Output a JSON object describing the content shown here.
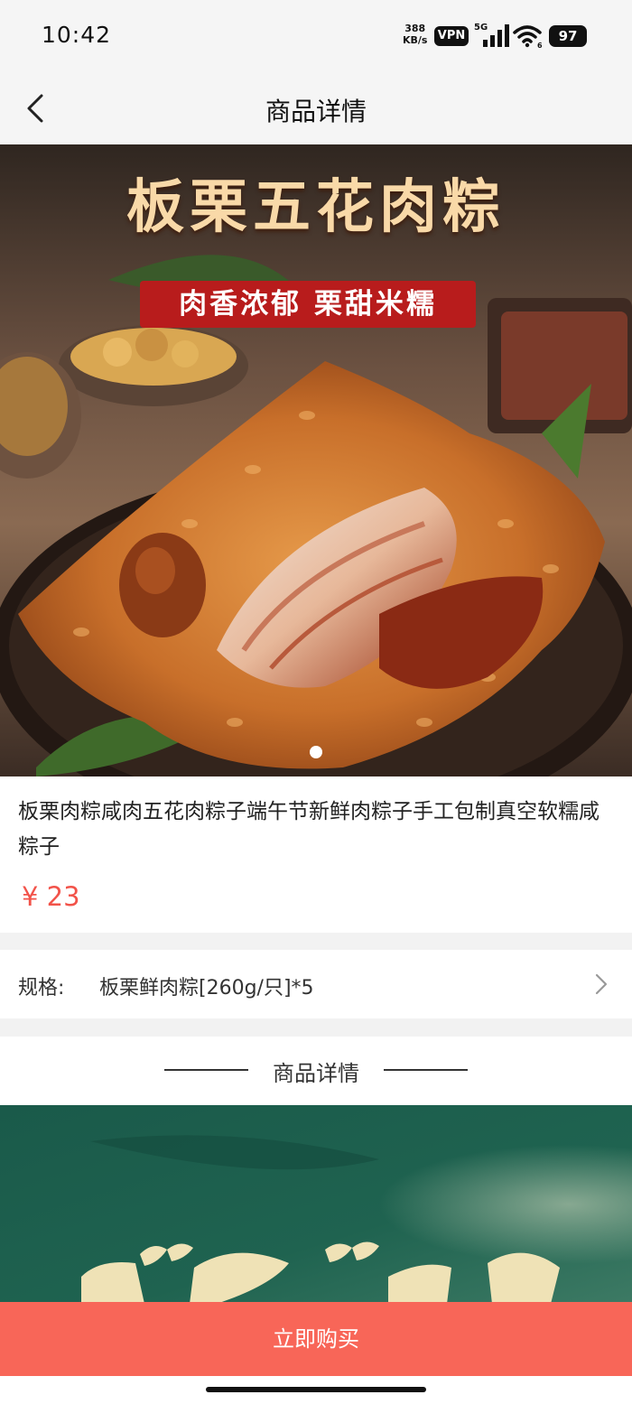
{
  "status_bar": {
    "time": "10:42",
    "net_speed_value": "388",
    "net_speed_unit": "KB/s",
    "vpn": "VPN",
    "network": "5G",
    "wifi_badge": "6",
    "battery": "97"
  },
  "nav": {
    "title": "商品详情",
    "back_icon": "chevron-left-icon"
  },
  "hero": {
    "headline": "板栗五花肉粽",
    "tagline": "肉香浓郁  栗甜米糯",
    "carousel_index": 1,
    "carousel_total": 1
  },
  "product": {
    "title": "板栗肉粽咸肉五花肉粽子端午节新鲜肉粽子手工包制真空软糯咸粽子",
    "price": "¥ 23"
  },
  "spec": {
    "label": "规格:",
    "value": "板栗鲜肉粽[260g/只]*5",
    "icon": "chevron-right-icon"
  },
  "detail": {
    "title": "商品详情"
  },
  "buy": {
    "label": "立即购买"
  },
  "colors": {
    "price": "#f2534a",
    "buy_button": "#f86658",
    "badge": "#b81c1c",
    "detail_bg": "#1c5b4c"
  }
}
